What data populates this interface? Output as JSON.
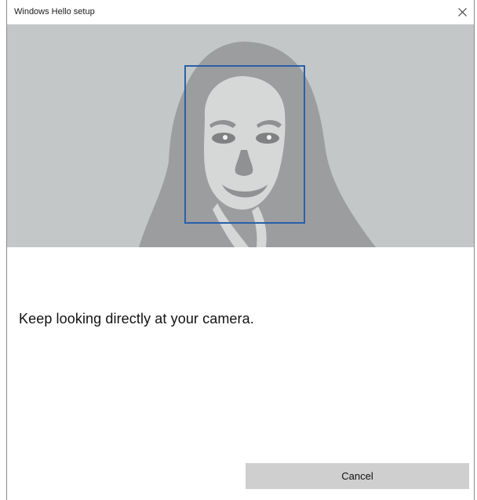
{
  "window": {
    "title": "Windows Hello setup",
    "close_icon": "close-icon"
  },
  "camera": {
    "background_color": "#c3c7c7",
    "silhouette_color": "#9b9d9f",
    "face_color": "#d6d8d8",
    "frame_color": "#2a5fa8"
  },
  "instruction": {
    "text": "Keep looking directly at your camera."
  },
  "footer": {
    "cancel_label": "Cancel"
  }
}
